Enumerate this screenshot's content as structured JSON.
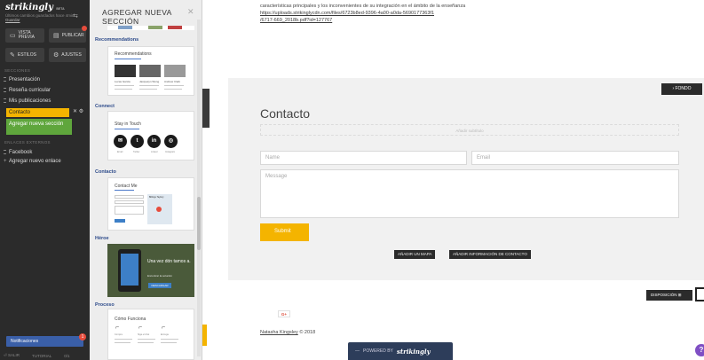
{
  "sidebar": {
    "logo": "strikingly",
    "logo_badge": "BETA",
    "autosave_text": "Últimos cambios guardados hace 4min.",
    "autosave_link": "Guardar",
    "preview_label": "VISTA PREVIA",
    "publish_label": "PUBLICAR",
    "styles_label": "ESTILOS",
    "settings_label": "AJUSTES",
    "sections_heading": "SECCIONES",
    "sections": [
      "Presentación",
      "Reseña curricular",
      "Mis publicaciones"
    ],
    "active_section": "Contacto",
    "add_section_label": "Agregar nueva sección",
    "external_links_heading": "ENLACES EXTERNOS",
    "external_links": [
      "Facebook"
    ],
    "add_link_label": "Agregar nuevo enlace",
    "notifications_label": "Notificaciones",
    "notifications_count": "1",
    "exit_label": "SALIR",
    "tutorial_label": "TUTORIAL",
    "tutorial_count": "0/1"
  },
  "panel": {
    "title": "AGREGAR NUEVA SECCIÓN",
    "categories": {
      "recommendations": "Recommendations",
      "connect": "Connect",
      "contact": "Contacto",
      "hero": "Héroe",
      "process": "Proceso"
    },
    "cards": {
      "recommendations_title": "Recommendations",
      "recommendations_names": [
        "Lucas Garcia",
        "Jacquelyn Wong",
        "Andrew Clark"
      ],
      "connect_title": "Stay in Touch",
      "connect_labels": [
        "Email",
        "Twitter",
        "Linked",
        "Instagram"
      ],
      "contact_title": "Contact Me",
      "contact_map_label": "Billings Taylory",
      "hero_title": "Una vez dón tamos a.",
      "hero_subtitle": "Encontrar la solución",
      "hero_button": "DESCARGAR",
      "process_title": "Cómo Funciona",
      "process_steps": [
        "Compra",
        "Siga el chat",
        "Entrega"
      ]
    }
  },
  "main": {
    "paragraph_lines": [
      "características principales y los inconvenientes de su integración en el ámbito de la enseñanza"
    ],
    "link_lines": [
      "https://uploads.strikinglycdn.com/files/6723b8ed-9396-4a00-a0da-5690177363f1",
      "/6717-669_2018b.pdf?id=127767"
    ],
    "fondo_label": "› FONDO",
    "contact_title": "Contacto",
    "subtitle_placeholder": "Añadir subtítulo",
    "name_placeholder": "Name",
    "email_placeholder": "Email",
    "message_placeholder": "Message",
    "submit_label": "Submit",
    "add_map_label": "AÑADIR UN MAPA",
    "add_contact_info_label": "AÑADIR INFORMACIÓN DE CONTACTO",
    "layout_label": "DISPOSICIÓN ⊞",
    "gplus_label": "G+",
    "copyright_name": "Natasha Kingsley",
    "copyright_year": "© 2018",
    "powered_label": "POWERED BY",
    "powered_brand": "strikingly",
    "help_label": "?"
  }
}
